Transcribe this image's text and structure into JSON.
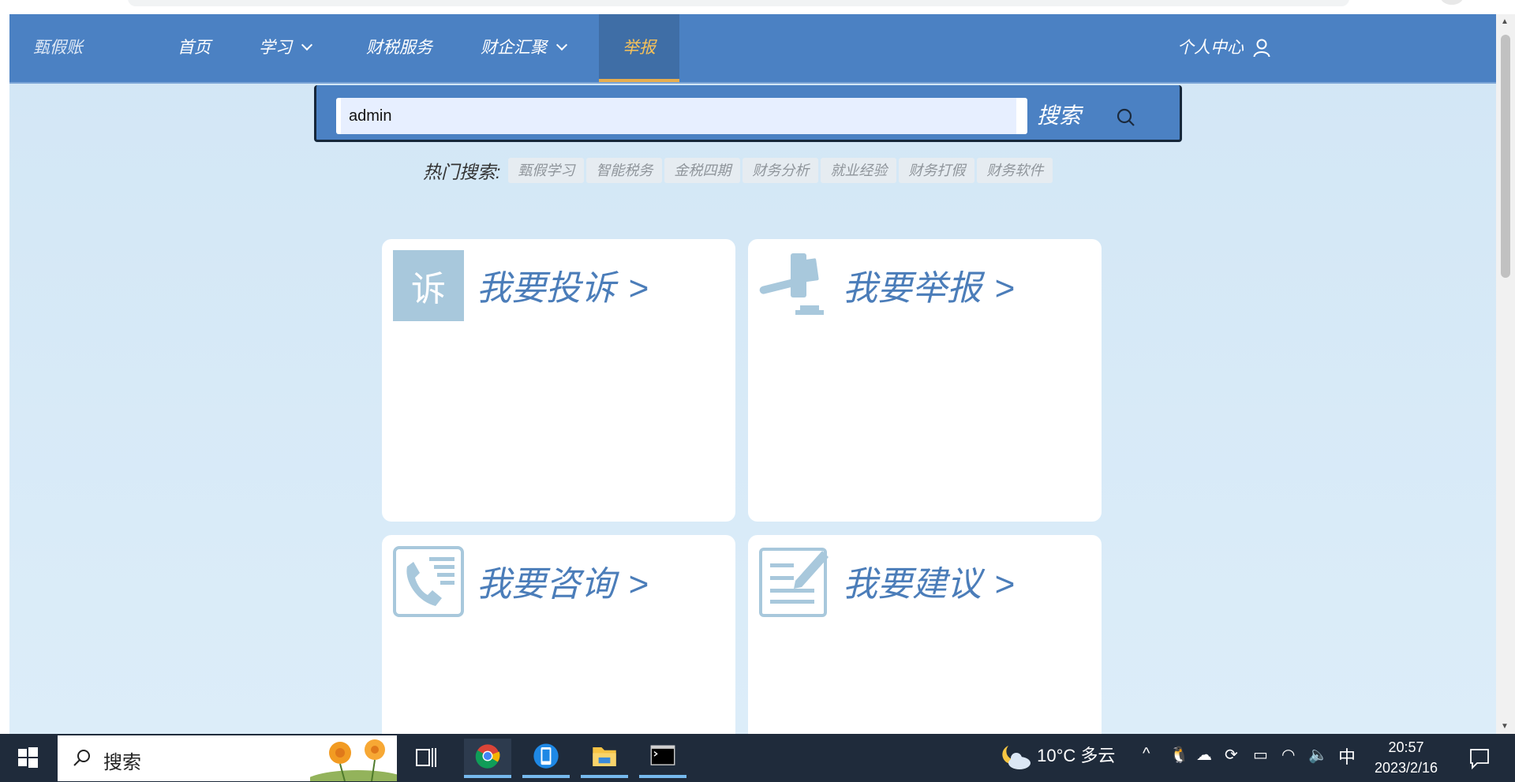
{
  "nav": {
    "brand": "甄假账",
    "items": [
      {
        "label": "首页"
      },
      {
        "label": "学习"
      },
      {
        "label": "财税服务"
      },
      {
        "label": "财企汇聚"
      },
      {
        "label": "举报"
      }
    ],
    "user_center": "个人中心"
  },
  "search": {
    "value": "admin",
    "button_label": "搜索",
    "hot_label": "热门搜索:",
    "hot_tags": [
      "甄假学习",
      "智能税务",
      "金税四期",
      "财务分析",
      "就业经验",
      "财务打假",
      "财务软件"
    ]
  },
  "cards": [
    {
      "title": "我要投诉",
      "arrow": ">",
      "icon_text": "诉",
      "icon": "complaint-icon"
    },
    {
      "title": "我要举报",
      "arrow": ">",
      "icon": "gavel-icon"
    },
    {
      "title": "我要咨询",
      "arrow": ">",
      "icon": "phone-icon"
    },
    {
      "title": "我要建议",
      "arrow": ">",
      "icon": "edit-document-icon"
    }
  ],
  "colors": {
    "nav_bg": "#4b81c3",
    "accent": "#f5c15a",
    "page_bg": "#d2e6f5",
    "card_title": "#4b7db9",
    "icon_fill": "#a8c8dc"
  },
  "taskbar": {
    "search_text": "搜索",
    "weather": "10°C 多云",
    "ime": "中",
    "time": "20:57",
    "date": "2023/2/16"
  }
}
